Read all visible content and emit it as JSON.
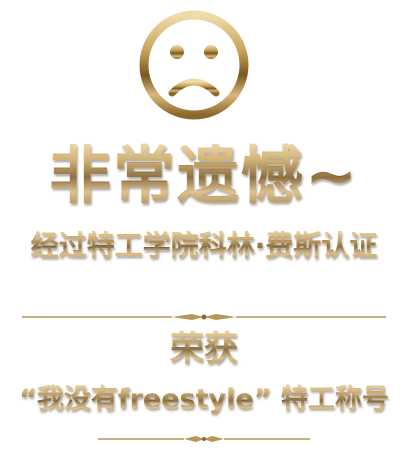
{
  "colors": {
    "gold_light": "#f0dcaa",
    "gold_mid": "#c9a45e",
    "gold_dark": "#7a5722",
    "background": "#ffffff"
  },
  "icons": {
    "face": "sad-face-icon",
    "divider_top": "ornamental-divider",
    "divider_bottom": "ornamental-divider"
  },
  "result": {
    "headline": "非常遗憾~",
    "subline": "经过特工学院科林·费斯认证",
    "award_label": "荣获",
    "award_title": "“我没有freestyle” 特工称号"
  }
}
